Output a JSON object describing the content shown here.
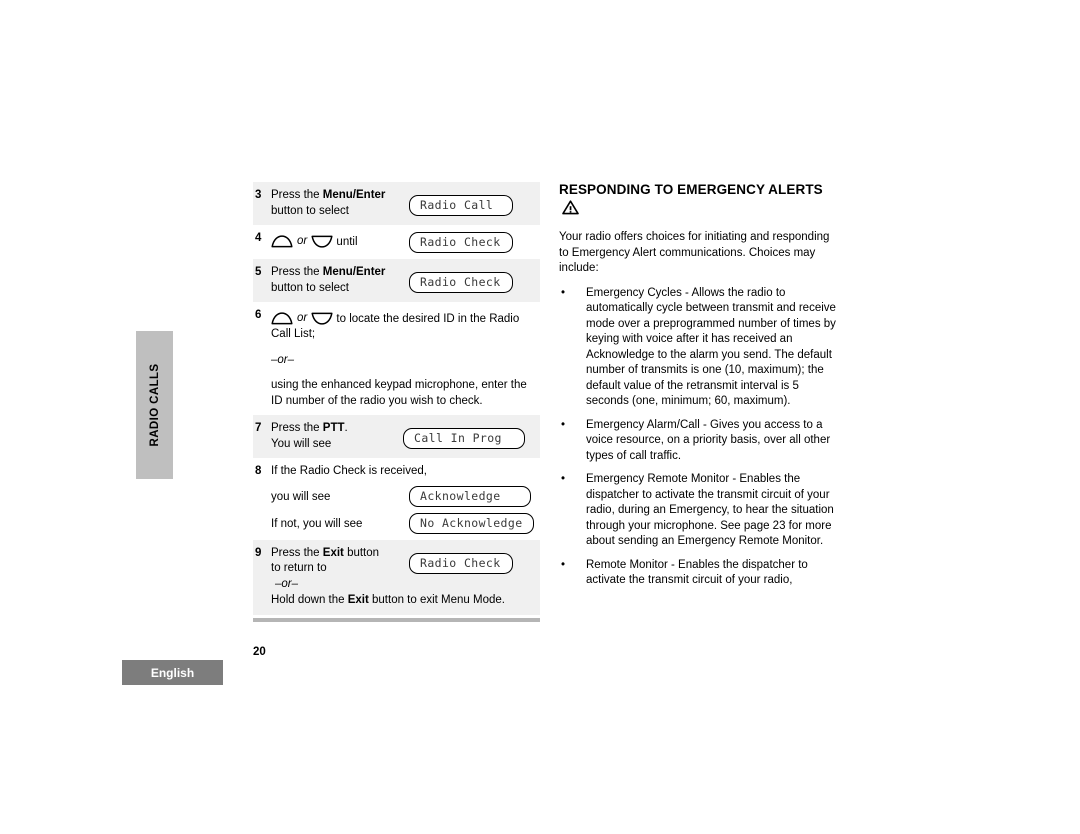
{
  "side_tab": {
    "label": "RADIO CALLS"
  },
  "footer": {
    "language": "English",
    "page_number": "20"
  },
  "procedure": {
    "rows": [
      {
        "number": "3",
        "text_line1_a": "Press the ",
        "text_line1_b": "Menu/Enter",
        "text_line2": "button to select",
        "lcd": "Radio Call"
      },
      {
        "number": "4",
        "after_arrows": " until",
        "or_word": "or",
        "lcd": "Radio Check"
      },
      {
        "number": "5",
        "text_line1_a": "Press the ",
        "text_line1_b": "Menu/Enter",
        "text_line2": "button to select",
        "lcd": "Radio Check"
      },
      {
        "number": "6",
        "or_word": "or",
        "after_arrows": " to locate the desired ID in the Radio Call List;",
        "or_divider": "–or–",
        "alt_text": "using the enhanced keypad microphone, enter the ID number of the radio you wish to check."
      },
      {
        "number": "7",
        "text_line1_a": "Press the ",
        "text_line1_b": "PTT",
        "text_line1_c": ".",
        "text_line2": "You will see",
        "lcd": "Call In Prog"
      },
      {
        "number": "8",
        "lead_text": "If the Radio Check is received,",
        "sub1_text": "you will see",
        "sub1_lcd": "Acknowledge",
        "sub2_text": "If not, you will see",
        "sub2_lcd": "No Acknowledge"
      },
      {
        "number": "9",
        "text_line1_a": "Press the ",
        "text_line1_b": "Exit",
        "text_line1_c": " button",
        "text_line2": "to return to",
        "or_divider": "–or–",
        "lcd": "Radio Check",
        "tail_a": "Hold down the ",
        "tail_b": "Exit",
        "tail_c": " button to exit Menu Mode."
      }
    ]
  },
  "right": {
    "heading": "RESPONDING TO EMERGENCY ALERTS",
    "warning_icon": "warning-triangle-icon",
    "intro": "Your radio offers choices for initiating and responding to Emergency Alert communications. Choices may include:",
    "bullet_char": "•",
    "bullets": [
      "Emergency Cycles - Allows the radio to automatically cycle between transmit and receive mode over a preprogrammed number of times by keying with voice after it has received an Acknowledge to the alarm you send. The default number of transmits is one (10, maximum); the default value of the retransmit interval is 5 seconds (one, minimum; 60, maximum).",
      "Emergency Alarm/Call - Gives you access to a voice resource, on a priority basis, over all other types of call traffic.",
      "Emergency Remote Monitor - Enables the dispatcher to activate the transmit circuit of your radio, during an Emergency, to hear the situation through your microphone. See page 23 for more about sending an Emergency Remote Monitor.",
      "Remote Monitor - Enables the dispatcher to activate the transmit circuit of your radio,"
    ]
  }
}
